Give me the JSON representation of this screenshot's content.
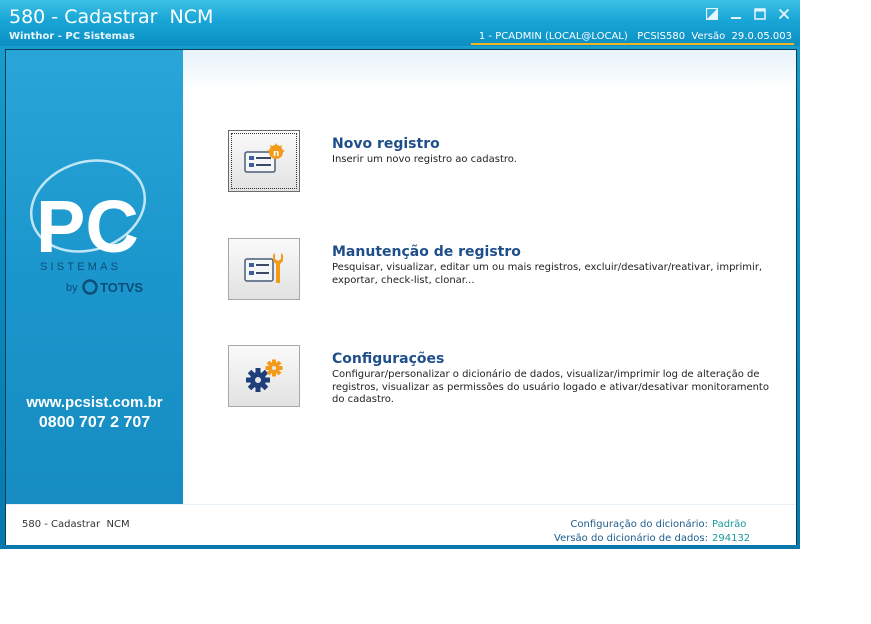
{
  "window": {
    "title": "580 - Cadastrar  NCM",
    "subtitle": "Winthor - PC Sistemas",
    "session": "1 - PCADMIN (LOCAL@LOCAL)   PCSIS580  Versão  29.0.05.003"
  },
  "brand": {
    "logo_text": "PC",
    "logo_sub": "SISTEMAS",
    "by": "by",
    "totvs": "TOTVS",
    "url": "www.pcsist.com.br",
    "phone": "0800 707 2 707"
  },
  "menu": [
    {
      "title": "Novo registro",
      "description": "Inserir um novo registro ao cadastro."
    },
    {
      "title": "Manutenção de registro",
      "description": "Pesquisar, visualizar, editar um ou mais registros, excluir/desativar/reativar, imprimir, exportar, check-list,  clonar..."
    },
    {
      "title": "Configurações",
      "description": "Configurar/personalizar o dicionário de dados, visualizar/imprimir log de alteração de registros, visualizar as permissões do usuário logado e ativar/desativar monitoramento do cadastro."
    }
  ],
  "status": {
    "left": "580 - Cadastrar  NCM",
    "dict_config_label": "Configuração do dicionário:",
    "dict_config_value": "Padrão",
    "dict_version_label": "Versão do dicionário de dados:",
    "dict_version_value": "294132"
  },
  "colors": {
    "titlebar": "#18a6d6",
    "accent": "#f0b323",
    "item_title": "#1f4f8a",
    "status_value": "#1a9a9a"
  }
}
